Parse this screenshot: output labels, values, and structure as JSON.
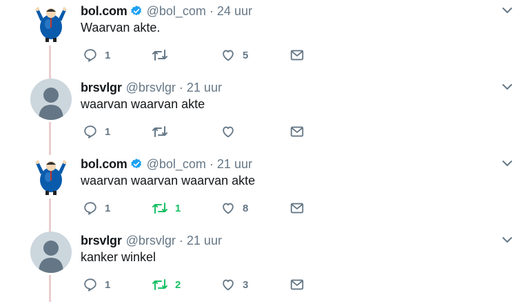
{
  "tweets": [
    {
      "name": "bol.com",
      "verified": true,
      "handle": "@bol_com",
      "time": "24 uur",
      "text": "Waarvan akte.",
      "avatar": "mascot-avatar",
      "replies": "1",
      "retweets": "",
      "likes": "5",
      "retweet_active": false
    },
    {
      "name": "brsvlgr",
      "verified": false,
      "handle": "@brsvlgr",
      "time": "21 uur",
      "text": "waarvan waarvan akte",
      "avatar": "default-avatar",
      "replies": "1",
      "retweets": "",
      "likes": "",
      "retweet_active": false
    },
    {
      "name": "bol.com",
      "verified": true,
      "handle": "@bol_com",
      "time": "21 uur",
      "text": "waarvan waarvan waarvan akte",
      "avatar": "mascot-avatar",
      "replies": "1",
      "retweets": "1",
      "likes": "8",
      "retweet_active": true
    },
    {
      "name": "brsvlgr",
      "verified": false,
      "handle": "@brsvlgr",
      "time": "21 uur",
      "text": "kanker winkel",
      "avatar": "default-avatar",
      "replies": "1",
      "retweets": "2",
      "likes": "3",
      "retweet_active": true
    }
  ],
  "separator": "·",
  "colors": {
    "accent": "#1da1f2",
    "muted": "#657786",
    "retweet_green": "#17bf63",
    "thread_line": "#eacdce",
    "mascot_blue": "#0a5bab"
  }
}
